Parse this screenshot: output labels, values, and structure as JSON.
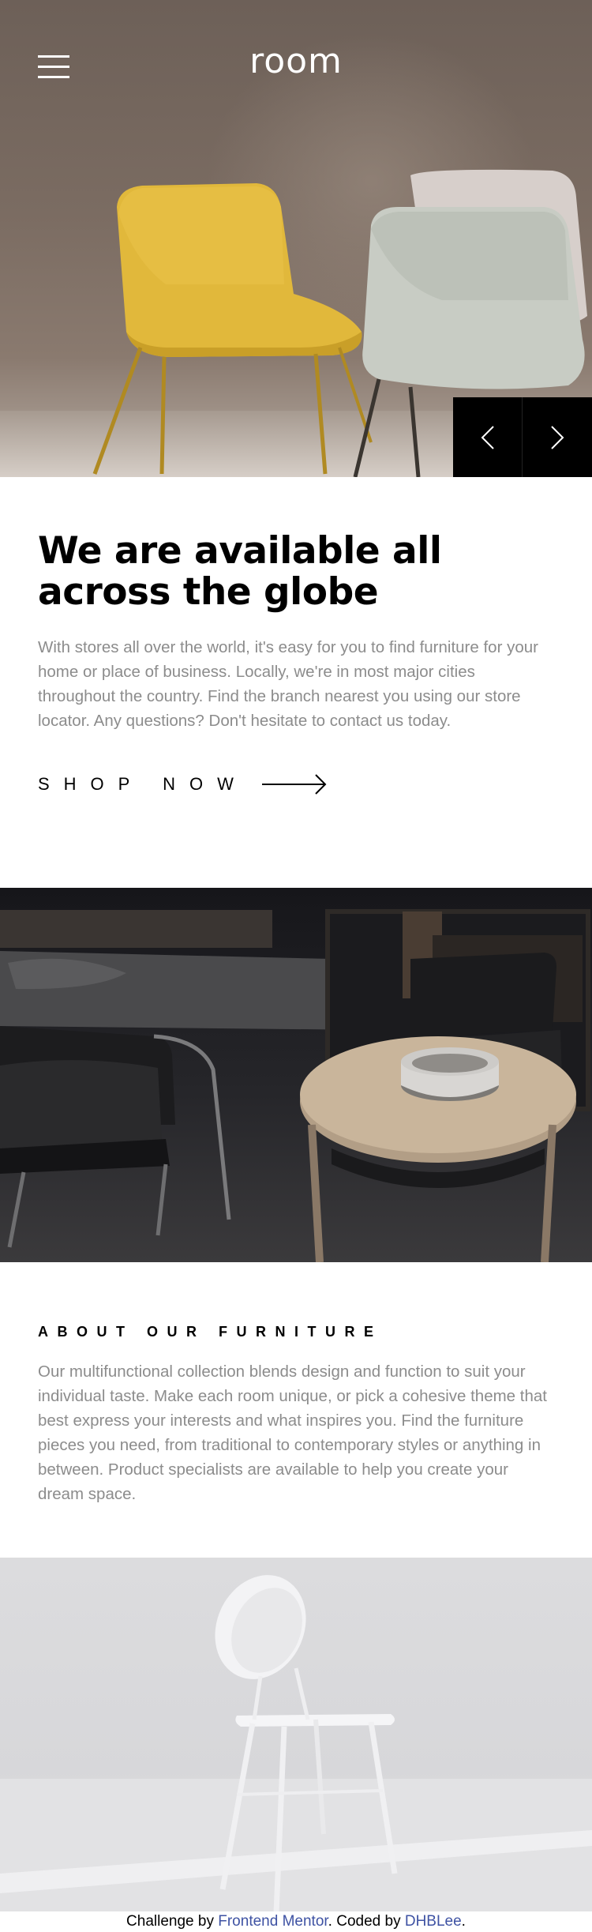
{
  "header": {
    "logo": "room",
    "menu_icon": "hamburger-menu-icon"
  },
  "hero": {
    "prev_icon": "chevron-left-icon",
    "next_icon": "chevron-right-icon"
  },
  "intro": {
    "title": "We are available all across the globe",
    "body": "With stores all over the world, it's easy for you to find furniture for your home or place of business. Locally, we're in most major cities throughout the country. Find the branch nearest you using our store locator. Any questions? Don't hesitate to contact us today.",
    "cta_label": "SHOP NOW",
    "cta_icon": "arrow-right-icon"
  },
  "about": {
    "title": "ABOUT OUR FURNITURE",
    "body": "Our multifunctional collection blends design and function to suit your individual taste. Make each room unique, or pick a cohesive theme that best express your interests and what inspires you. Find the furniture pieces you need, from traditional to contemporary styles or anything in between. Product specialists are available to help you create your dream space."
  },
  "attribution": {
    "prefix": "Challenge by ",
    "challenge_link": "Frontend Mentor",
    "middle": ". Coded by ",
    "author_link": "DHBLee",
    "suffix": "."
  },
  "colors": {
    "link": "#3e52a3",
    "body_text": "#8c8c8c",
    "chair_yellow": "#e2b93b",
    "chair_sage": "#c7ccc3"
  }
}
